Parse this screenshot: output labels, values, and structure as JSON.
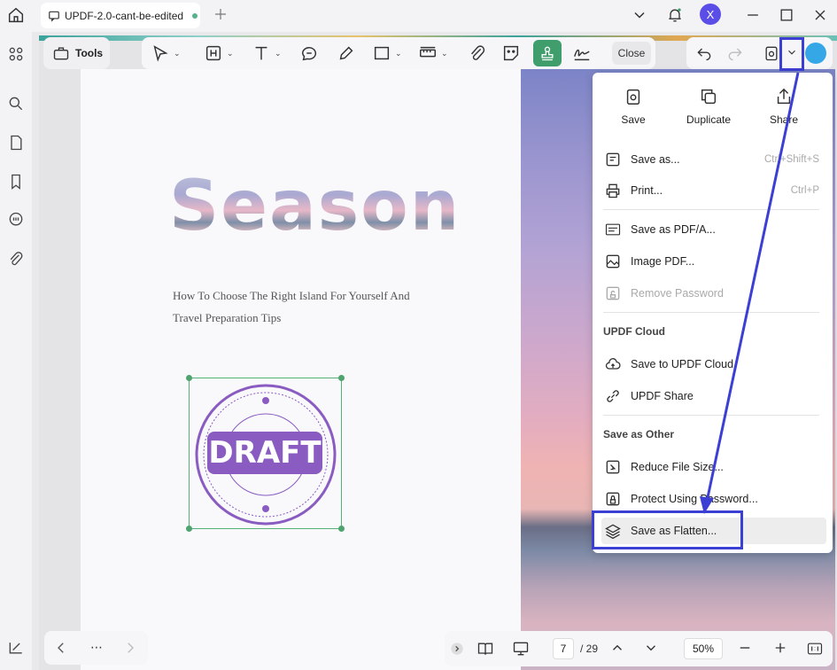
{
  "tab": {
    "title": "UPDF-2.0-cant-be-edited"
  },
  "avatar_letter": "X",
  "tools_label": "Tools",
  "close_label": "Close",
  "document": {
    "heading": "Season",
    "subtitle_line1": "How To Choose The Right Island For Yourself And",
    "subtitle_line2": "Travel Preparation Tips",
    "stamp_text": "DRAFT"
  },
  "menu": {
    "top_actions": [
      "Save",
      "Duplicate",
      "Share"
    ],
    "save_as": {
      "label": "Save as...",
      "shortcut": "Ctrl+Shift+S"
    },
    "print": {
      "label": "Print...",
      "shortcut": "Ctrl+P"
    },
    "save_pdfa": "Save as PDF/A...",
    "image_pdf": "Image PDF...",
    "remove_password": "Remove Password",
    "cloud_section": "UPDF Cloud",
    "save_cloud": "Save to UPDF Cloud",
    "updf_share": "UPDF Share",
    "other_section": "Save as Other",
    "reduce": "Reduce File Size...",
    "protect": "Protect Using Password...",
    "flatten": "Save as Flatten..."
  },
  "pagination": {
    "current": "7",
    "total": "/ 29",
    "zoom": "50%"
  },
  "colors": {
    "accent": "#3c3fd3",
    "stamp_tool": "#3f9e6c",
    "draft": "#8a5cc2"
  }
}
